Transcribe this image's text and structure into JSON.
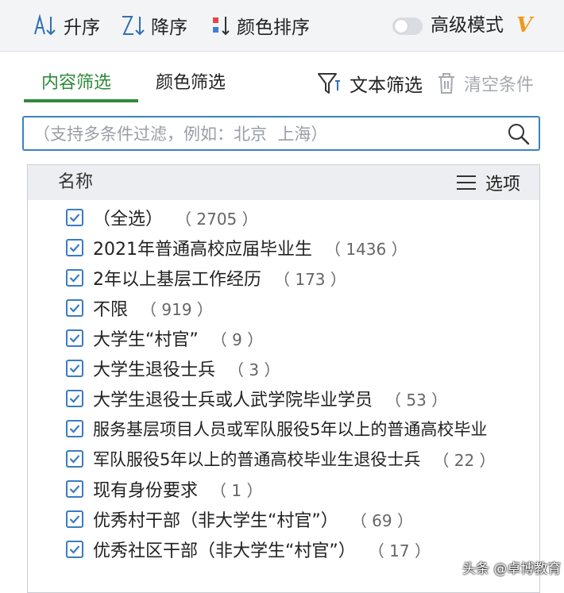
{
  "toolbar": {
    "sort_asc": "升序",
    "sort_desc": "降序",
    "color_sort": "颜色排序",
    "advanced_mode": "高级模式",
    "vip_mark": "V",
    "advanced_mode_on": false
  },
  "tabs": [
    {
      "label": "内容筛选",
      "active": true
    },
    {
      "label": "颜色筛选",
      "active": false
    }
  ],
  "actions": {
    "text_filter": "文本筛选",
    "clear_conditions": "清空条件"
  },
  "search": {
    "placeholder": "（支持多条件过滤，例如：北京  上海）"
  },
  "list": {
    "header_name": "名称",
    "header_options": "选项",
    "items": [
      {
        "label": "（全选）",
        "count": "（ 2705 ）",
        "checked": true
      },
      {
        "label": "2021年普通高校应届毕业生",
        "count": "（ 1436 ）",
        "checked": true
      },
      {
        "label": "2年以上基层工作经历",
        "count": "（ 173 ）",
        "checked": true
      },
      {
        "label": "不限",
        "count": "（ 919 ）",
        "checked": true
      },
      {
        "label": "大学生“村官”",
        "count": "（ 9 ）",
        "checked": true
      },
      {
        "label": "大学生退役士兵",
        "count": "（ 3 ）",
        "checked": true
      },
      {
        "label": "大学生退役士兵或人武学院毕业学员",
        "count": "（ 53 ）",
        "checked": true
      },
      {
        "label": "服务基层项目人员或军队服役5年以上的普通高校毕业",
        "count": "",
        "checked": true
      },
      {
        "label": "军队服役5年以上的普通高校毕业生退役士兵",
        "count": "（ 22 ）",
        "checked": true
      },
      {
        "label": "现有身份要求",
        "count": "（ 1 ）",
        "checked": true
      },
      {
        "label": "优秀村干部（非大学生“村官”）",
        "count": "（ 69 ）",
        "checked": true
      },
      {
        "label": "优秀社区干部（非大学生“村官”）",
        "count": "（ 17 ）",
        "checked": true
      }
    ]
  },
  "watermark": "头条 @卓博教育",
  "colors": {
    "accent_green": "#2f8a3b",
    "checkbox_blue": "#3a7cc2",
    "search_border": "#3b82c4",
    "vip_orange": "#f09a1a"
  }
}
